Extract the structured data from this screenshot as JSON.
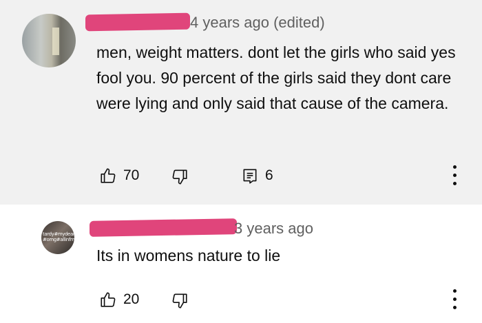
{
  "comments": [
    {
      "avatar": "landscape-avatar",
      "timestamp": "4 years ago (edited)",
      "text": "men, weight matters. dont let the girls who said yes fool you. 90 percent of the girls said they dont care were lying and only said that cause of the camera.",
      "likes": "70",
      "replies": "6"
    },
    {
      "avatar": "photo-avatar",
      "avatar_text": "hashtag",
      "timestamp": "3 years ago",
      "text": "Its in womens nature to lie",
      "likes": "20"
    }
  ],
  "icons": {
    "like": "thumbs-up-icon",
    "dislike": "thumbs-down-icon",
    "replies": "reply-icon",
    "more": "more-options-icon"
  },
  "colors": {
    "redaction": "#e0457b",
    "first_comment_bg": "#f1f1f1",
    "meta_text": "#606060"
  }
}
